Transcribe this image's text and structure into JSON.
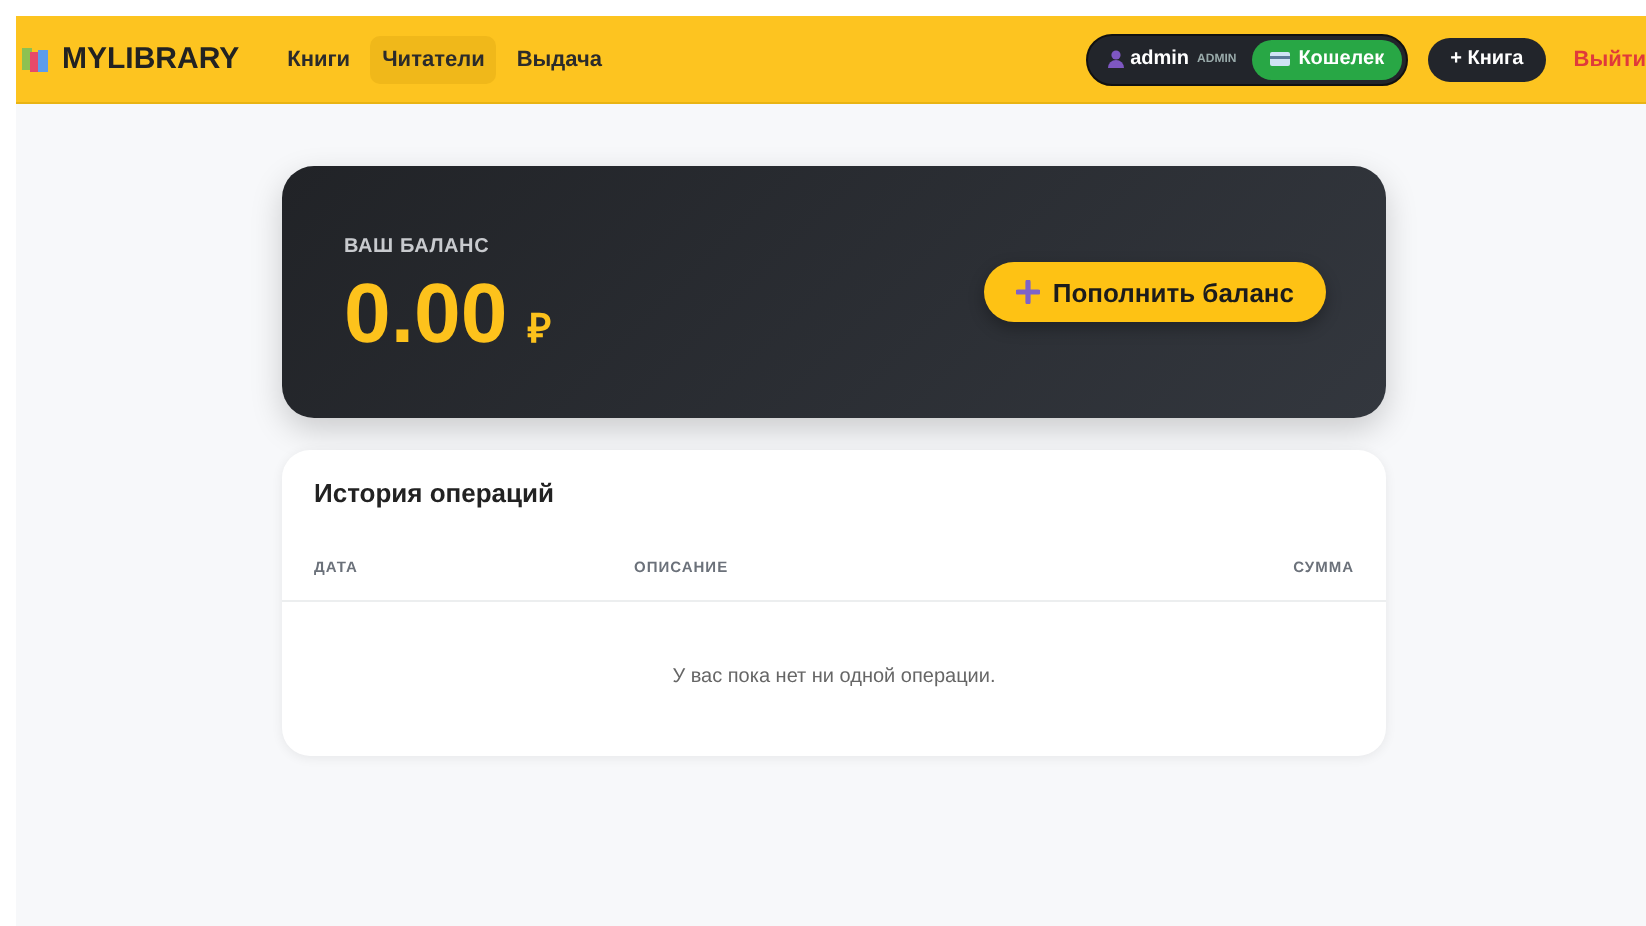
{
  "header": {
    "logo": "MYLIBRARY",
    "nav": [
      {
        "label": "Книги",
        "selected": false
      },
      {
        "label": "Читатели",
        "selected": true
      },
      {
        "label": "Выдача",
        "selected": false
      }
    ],
    "user": {
      "name": "admin",
      "role": "ADMIN"
    },
    "wallet_button": "Кошелек",
    "add_book_button": "+ Книга",
    "logout": "Выйти"
  },
  "balance": {
    "label": "ВАШ БАЛАНС",
    "amount": "0.00",
    "currency": "₽",
    "top_up_button": "Пополнить баланс"
  },
  "history": {
    "title": "История операций",
    "columns": [
      "ДАТА",
      "ОПИСАНИЕ",
      "СУММА"
    ],
    "empty_message": "У вас пока нет ни одной операции."
  }
}
